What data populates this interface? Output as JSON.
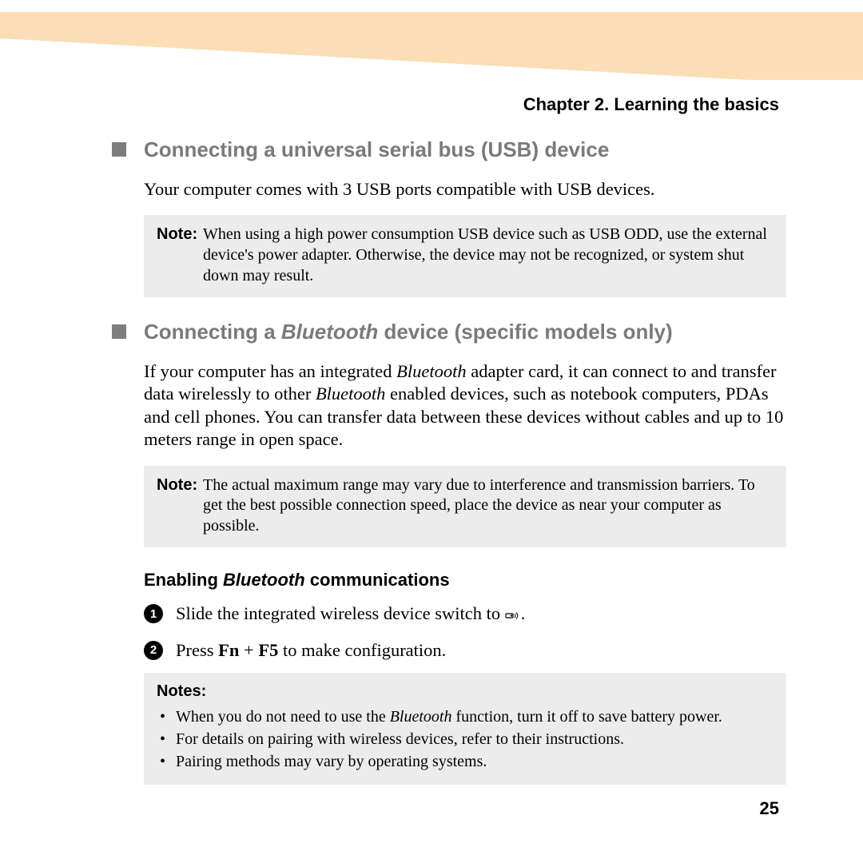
{
  "chapter": "Chapter 2. Learning the basics",
  "section1": {
    "title": "Connecting a universal serial bus (USB) device",
    "body": "Your computer comes with 3 USB ports compatible with USB devices.",
    "note_label": "Note:",
    "note_text": "When using a high power consumption USB device such as USB ODD, use the external device's power adapter. Otherwise, the device may not be recognized, or system shut down may result."
  },
  "section2": {
    "title_pre": "Connecting a ",
    "title_ital": "Bluetooth",
    "title_post": " device (specific models only)",
    "body_pre": "If your computer has an integrated ",
    "body_i1": "Bluetooth",
    "body_mid": " adapter card, it can connect to and transfer data wirelessly to other ",
    "body_i2": "Bluetooth",
    "body_post": " enabled devices, such as notebook computers, PDAs and cell phones. You can transfer data between these devices without cables and up to 10 meters range in open space.",
    "note_label": "Note:",
    "note_text": "The actual maximum range may vary due to interference and transmission barriers. To get the best possible connection speed, place the device as near your computer as possible."
  },
  "subsection": {
    "title_pre": "Enabling ",
    "title_ital": "Bluetooth",
    "title_post": " communications",
    "step1_num": "1",
    "step1_pre": "Slide the integrated wireless device switch to ",
    "step1_post": ".",
    "step2_num": "2",
    "step2_pre": "Press ",
    "step2_b1": "Fn",
    "step2_mid": " + ",
    "step2_b2": "F5",
    "step2_post": " to make configuration."
  },
  "notes": {
    "heading": "Notes:",
    "n1_pre": "When you do not need to use the ",
    "n1_ital": "Bluetooth",
    "n1_post": " function, turn it off to save battery power.",
    "n2": "For details on pairing with wireless devices, refer to their instructions.",
    "n3": "Pairing methods may vary by operating systems."
  },
  "page_number": "25"
}
